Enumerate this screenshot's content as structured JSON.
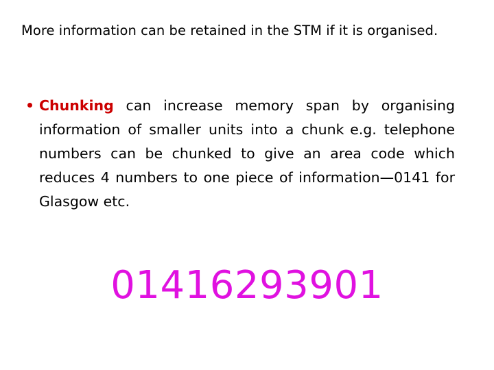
{
  "slide": {
    "background_color": "#ffffff",
    "intro": {
      "text": "More information can be retained in the STM if it is organised."
    },
    "bullets": [
      {
        "marker": "•",
        "marker_color": "#cc0000",
        "keyword": "Chunking",
        "keyword_color": "#cc0000",
        "rest_part_1": " can increase memory span by organising information of smaller units into a chunk",
        "rest_part_2": "e.g. telephone numbers can be chunked to give an area code which reduces 4 numbers to one piece of information—0141 for Glasgow etc.",
        "full_text": "Chunking can increase memory span by organising information of smaller units into a chunk  e.g. telephone numbers can be chunked to give an area code which reduces 4 numbers to one piece of information—0141 for Glasgow etc."
      }
    ],
    "phone_example": {
      "number": "01416293901",
      "color": "#e011e0"
    }
  }
}
